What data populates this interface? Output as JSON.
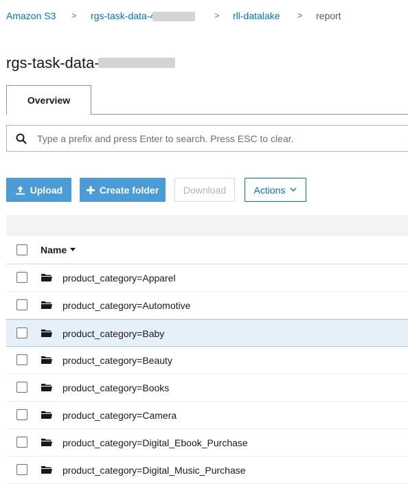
{
  "breadcrumb": {
    "root": "Amazon S3",
    "bucket": "rgs-task-data-4",
    "folder": "rll-datalake",
    "current": "report",
    "separator": ">"
  },
  "title": "rgs-task-data-",
  "tabs": [
    {
      "label": "Overview",
      "active": true
    }
  ],
  "search": {
    "placeholder": "Type a prefix and press Enter to search. Press ESC to clear.",
    "value": ""
  },
  "toolbar": {
    "upload_label": "Upload",
    "create_folder_label": "Create folder",
    "download_label": "Download",
    "actions_label": "Actions"
  },
  "table": {
    "columns": [
      {
        "label": "Name",
        "sort": "descending"
      }
    ],
    "rows": [
      {
        "name": "product_category=Apparel",
        "type": "folder",
        "highlighted": false
      },
      {
        "name": "product_category=Automotive",
        "type": "folder",
        "highlighted": false
      },
      {
        "name": "product_category=Baby",
        "type": "folder",
        "highlighted": true
      },
      {
        "name": "product_category=Beauty",
        "type": "folder",
        "highlighted": false
      },
      {
        "name": "product_category=Books",
        "type": "folder",
        "highlighted": false
      },
      {
        "name": "product_category=Camera",
        "type": "folder",
        "highlighted": false
      },
      {
        "name": "product_category=Digital_Ebook_Purchase",
        "type": "folder",
        "highlighted": false
      },
      {
        "name": "product_category=Digital_Music_Purchase",
        "type": "folder",
        "highlighted": false
      }
    ]
  },
  "colors": {
    "link": "#0073bb",
    "primary_button": "#4b9bd6",
    "row_highlight": "#e7f0f8"
  },
  "icons": {
    "search": "search-icon",
    "upload": "upload-icon",
    "create": "plus-icon",
    "actions": "chevron-down-icon",
    "folder": "folder-icon",
    "sort": "caret-down-icon"
  }
}
